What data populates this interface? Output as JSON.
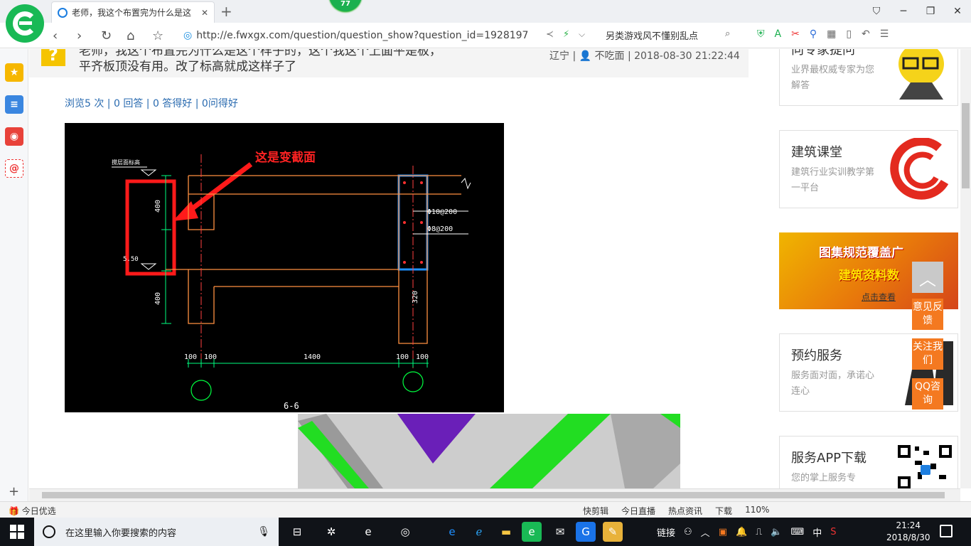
{
  "browser": {
    "tab_title": "老师，我这个布置完为什么是这",
    "tab_close": "✕",
    "new_tab": "+",
    "badge_count": "77",
    "url": "http://e.fwxgx.com/question/question_show?question_id=1928197",
    "hot_text": "另类游戏风不懂别乱点"
  },
  "question": {
    "icon": "?",
    "title_line1": "老师，我这个布置完为什么是这个样子的，这个我这个上面平是板，",
    "title_line2": "平齐板顶没有用。改了标高就成这样子了",
    "location": "辽宁",
    "user": "不吃面",
    "datetime": "2018-08-30 21:22:44",
    "stats": "浏览5 次 | 0 回答 | 0 答得好 | 0问得好"
  },
  "cad": {
    "annotation": "这是变截面",
    "top_label": "搅层面标高",
    "dim_400a": "400",
    "dim_400b": "400",
    "dim_320": "320",
    "level": "5.50",
    "rebar1": "Φ10@200",
    "rebar2": "Φ8@200",
    "dim_100a": "100",
    "dim_100b": "100",
    "dim_1400": "1400",
    "dim_100c": "100",
    "dim_100d": "100",
    "section": "6-6"
  },
  "sidebar": {
    "card1_title": "向专家提问",
    "card1_sub": "业界最权威专家为您解答",
    "card2_title": "建筑课堂",
    "card2_sub": "建筑行业实训教学第一平台",
    "banner_line1": "图集规范覆盖广",
    "banner_line2": "建筑资料数",
    "banner_link": "点击查看",
    "card3_title": "预约服务",
    "card3_sub": "服务面对面，承诺心连心",
    "card4_title": "服务APP下载",
    "card4_sub": "您的掌上服务专"
  },
  "tools": {
    "to_top": "︿",
    "feedback": "意见反馈",
    "follow": "关注我们",
    "qq": "QQ咨询"
  },
  "statusbar": {
    "left": "今日优选",
    "items": [
      "快剪辑",
      "今日直播",
      "热点资讯",
      "下载",
      "110%"
    ]
  },
  "taskbar": {
    "search_placeholder": "在这里输入你要搜索的内容",
    "link_label": "链接",
    "ime": "中",
    "time": "21:24",
    "date": "2018/8/30"
  }
}
